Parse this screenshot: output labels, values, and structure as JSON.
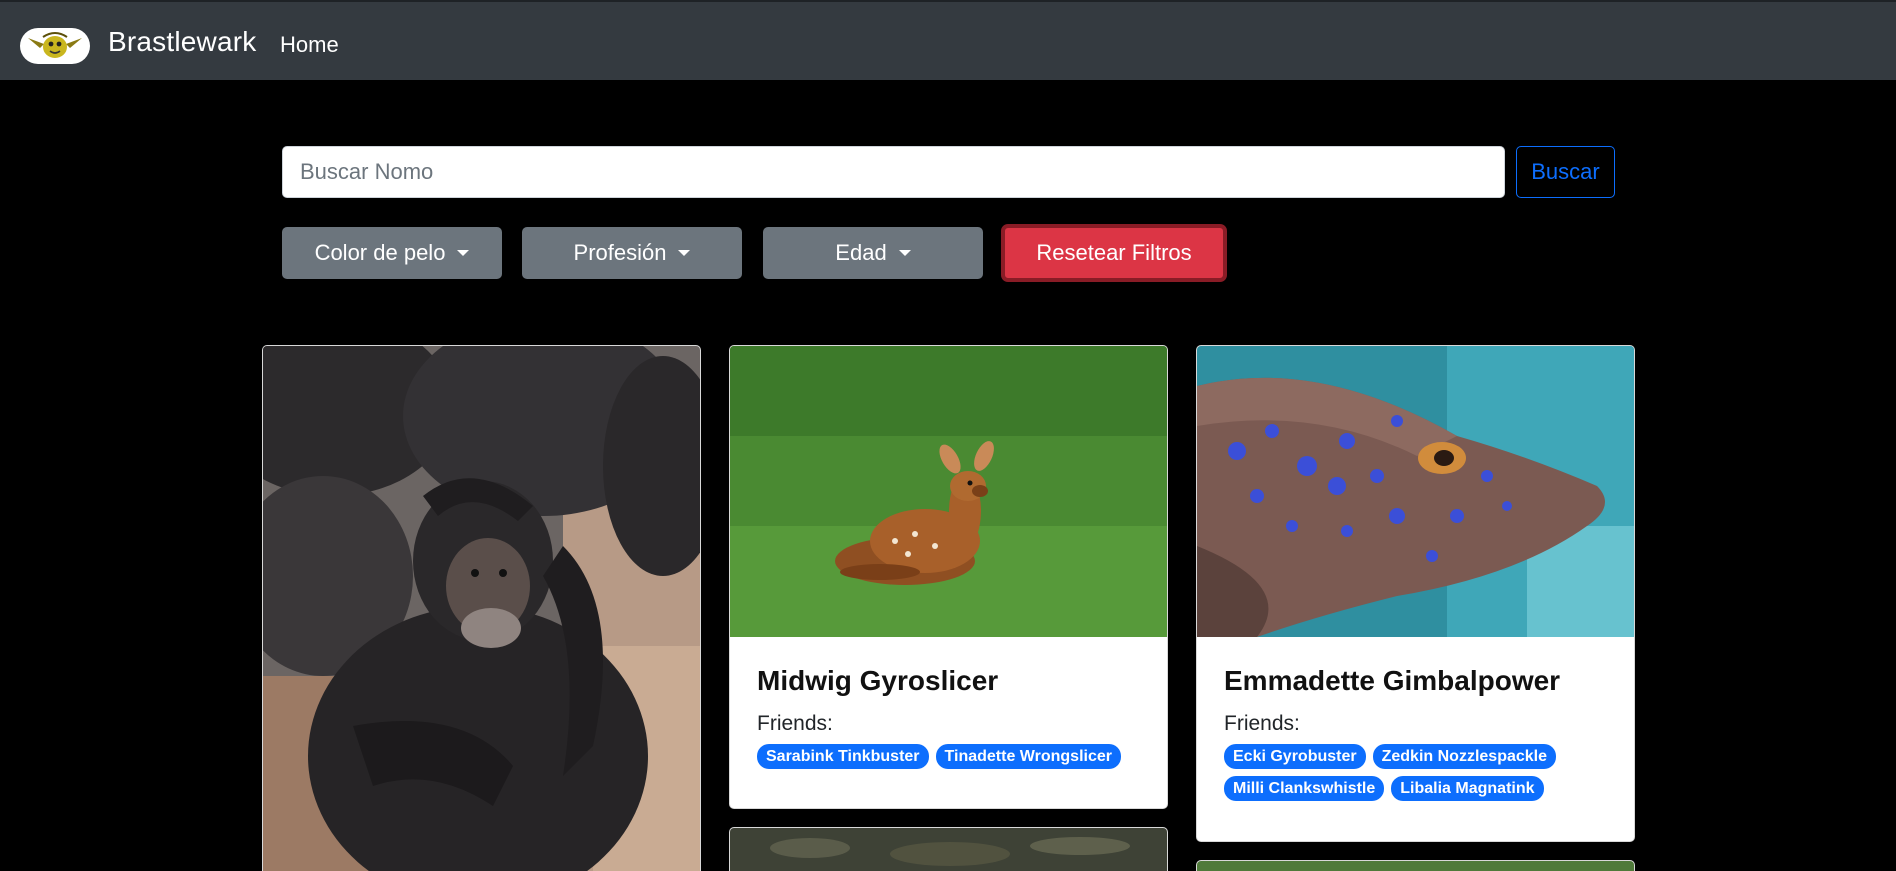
{
  "navbar": {
    "brand": "Brastlewark",
    "home_link": "Home",
    "logo_icon": "gnome-logo-icon"
  },
  "search": {
    "placeholder": "Buscar Nomo",
    "value": "",
    "button_label": "Buscar"
  },
  "filters": {
    "hair_color_label": "Color de pelo",
    "profession_label": "Profesión",
    "age_label": "Edad",
    "reset_label": "Resetear Filtros"
  },
  "cards": [
    {
      "image": "chimpanzee-photo",
      "name": "",
      "friends_label": "",
      "friends": []
    },
    {
      "image": "fawn-photo",
      "name": "Midwig Gyroslicer",
      "friends_label": "Friends:",
      "friends": [
        "Sarabink Tinkbuster",
        "Tinadette Wrongslicer"
      ]
    },
    {
      "image": "stingray-photo",
      "name": "Emmadette Gimbalpower",
      "friends_label": "Friends:",
      "friends": [
        "Ecki Gyrobuster",
        "Zedkin Nozzlespackle",
        "Milli Clankswhistle",
        "Libalia Magnatink"
      ]
    }
  ],
  "colors": {
    "navbar_bg": "#343a40",
    "page_bg": "#000000",
    "primary": "#0d6efd",
    "secondary": "#6c757d",
    "danger": "#dc3545"
  }
}
